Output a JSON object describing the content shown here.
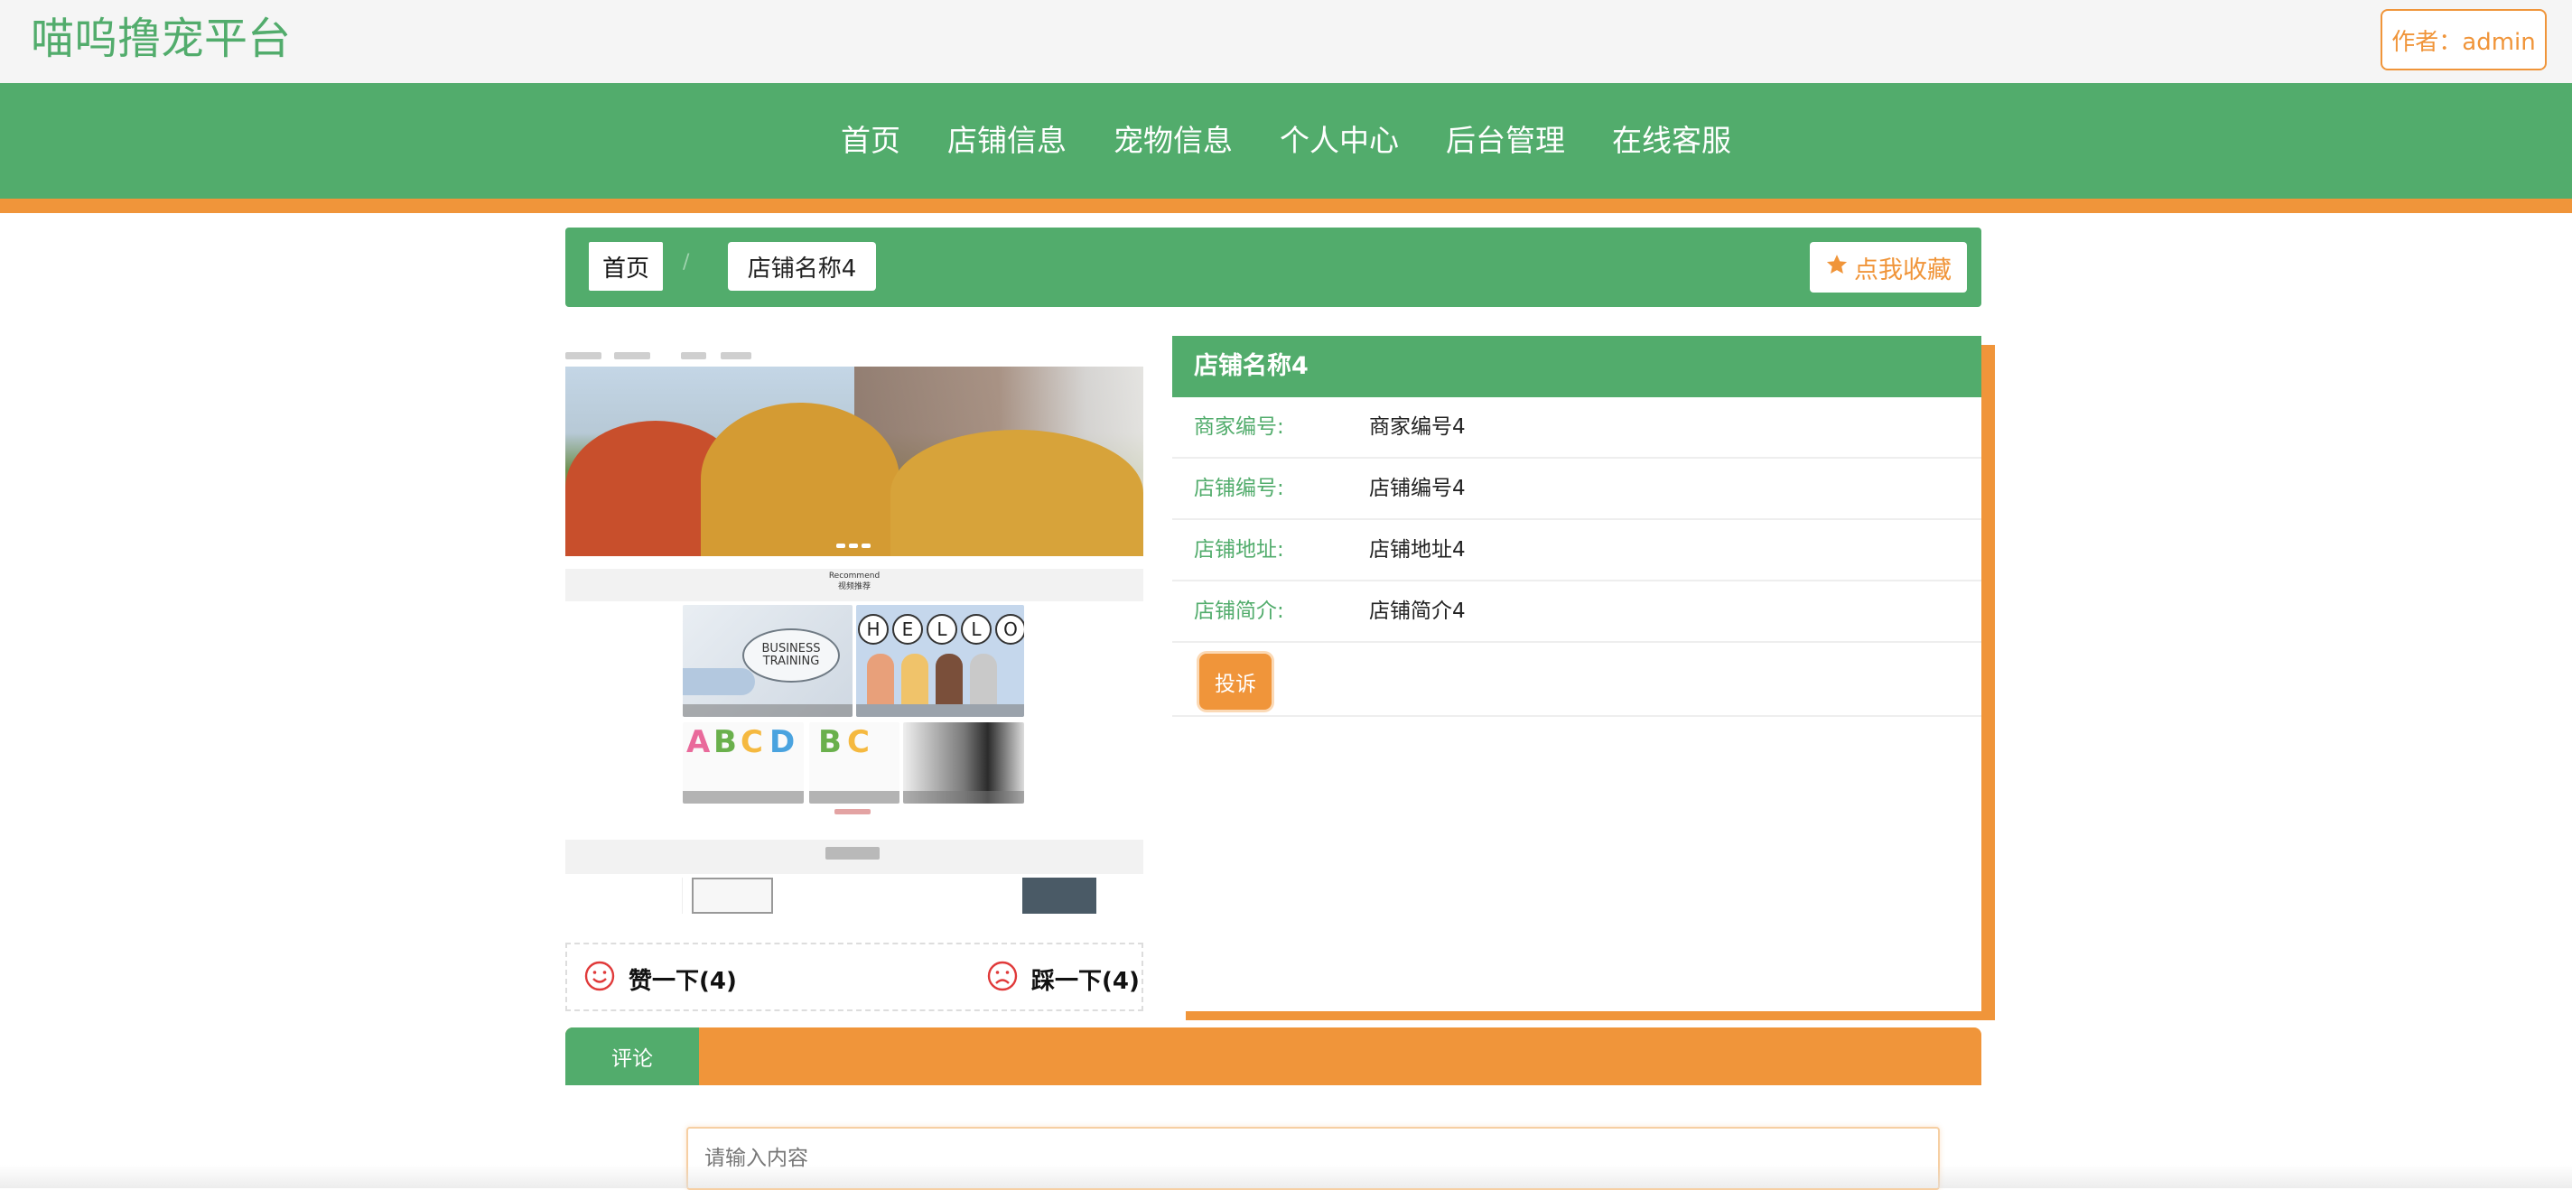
{
  "header": {
    "site_title": "喵呜撸宠平台",
    "author_label": "作者：admin"
  },
  "nav": {
    "items": [
      {
        "label": "首页"
      },
      {
        "label": "店铺信息"
      },
      {
        "label": "宠物信息"
      },
      {
        "label": "个人中心"
      },
      {
        "label": "后台管理"
      },
      {
        "label": "在线客服"
      }
    ]
  },
  "breadcrumb": {
    "home": "首页",
    "separator": "/",
    "current": "店铺名称4"
  },
  "favorite": {
    "label": "点我收藏",
    "icon": "star-icon"
  },
  "preview": {
    "recommend_en": "Recommend",
    "recommend_cn": "视频推荐",
    "tile_text": "BUSINESS TRAINING",
    "hello_letters": [
      "H",
      "E",
      "L",
      "L",
      "O"
    ],
    "abc_letters": [
      "A",
      "B",
      "C",
      "D"
    ]
  },
  "votes": {
    "like": {
      "label": "赞一下(4)",
      "icon": "smile-icon"
    },
    "dislike": {
      "label": "踩一下(4)",
      "icon": "frown-icon"
    }
  },
  "shop_info": {
    "title": "店铺名称4",
    "rows": [
      {
        "label": "商家编号:",
        "value": "商家编号4"
      },
      {
        "label": "店铺编号:",
        "value": "店铺编号4"
      },
      {
        "label": "店铺地址:",
        "value": "店铺地址4"
      },
      {
        "label": "店铺简介:",
        "value": "店铺简介4"
      }
    ],
    "complain_label": "投诉"
  },
  "comment": {
    "tab_label": "评论",
    "placeholder": "请输入内容"
  },
  "colors": {
    "primary_green": "#52ac6c",
    "accent_orange": "#f0953a",
    "vote_red": "#e03a3a"
  }
}
